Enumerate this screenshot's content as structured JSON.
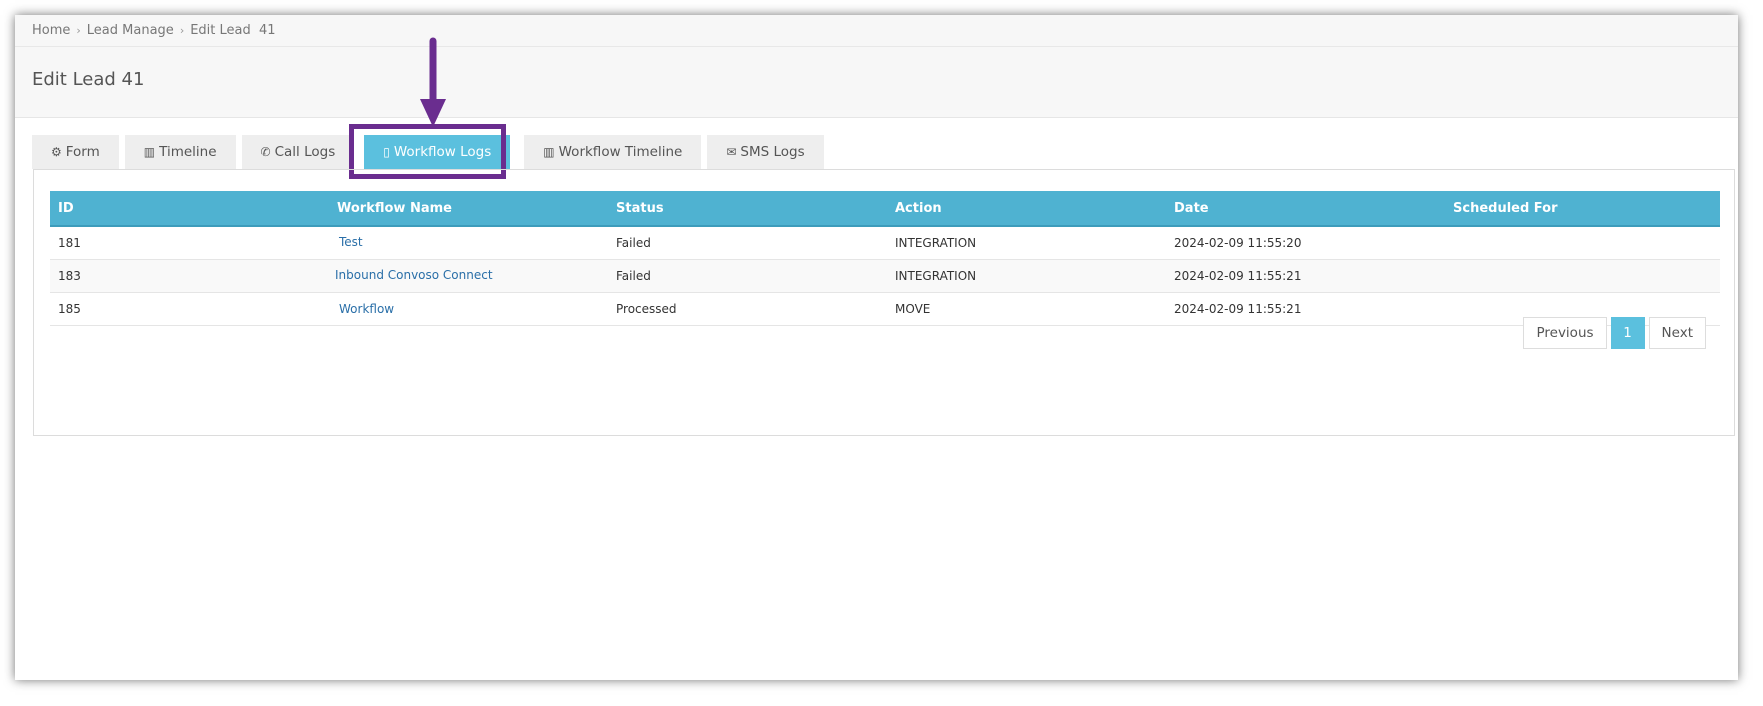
{
  "breadcrumb": {
    "home": "Home",
    "lead_manage": "Lead Manage",
    "current": "Edit Lead  41",
    "separator": "›"
  },
  "page_title": "Edit Lead 41",
  "tabs": [
    {
      "label": "Form",
      "icon": "gears-icon",
      "glyph": "⚙"
    },
    {
      "label": "Timeline",
      "icon": "bar-chart-icon",
      "glyph": "▥"
    },
    {
      "label": "Call Logs",
      "icon": "phone-icon",
      "glyph": "✆"
    },
    {
      "label": "Workflow Logs",
      "icon": "file-icon",
      "glyph": "▯",
      "active": true
    },
    {
      "label": "Workflow Timeline",
      "icon": "bar-chart-icon",
      "glyph": "▥"
    },
    {
      "label": "SMS Logs",
      "icon": "envelope-icon",
      "glyph": "✉"
    }
  ],
  "table": {
    "headers": [
      "ID",
      "Workflow Name",
      "Status",
      "Action",
      "Date",
      "Scheduled For"
    ],
    "rows": [
      {
        "id": "181",
        "workflow_name": "Test",
        "status": "Failed",
        "action": "INTEGRATION",
        "date": "2024-02-09 11:55:20",
        "scheduled_for": ""
      },
      {
        "id": "183",
        "workflow_name": "Inbound Convoso Connect",
        "status": "Failed",
        "action": "INTEGRATION",
        "date": "2024-02-09 11:55:21",
        "scheduled_for": ""
      },
      {
        "id": "185",
        "workflow_name": "Workflow",
        "status": "Processed",
        "action": "MOVE",
        "date": "2024-02-09 11:55:21",
        "scheduled_for": ""
      }
    ]
  },
  "pagination": {
    "previous": "Previous",
    "current": "1",
    "next": "Next"
  },
  "colors": {
    "accent": "#5bc0de",
    "table_header": "#4fb2d1",
    "highlight": "#6a2d8f"
  }
}
